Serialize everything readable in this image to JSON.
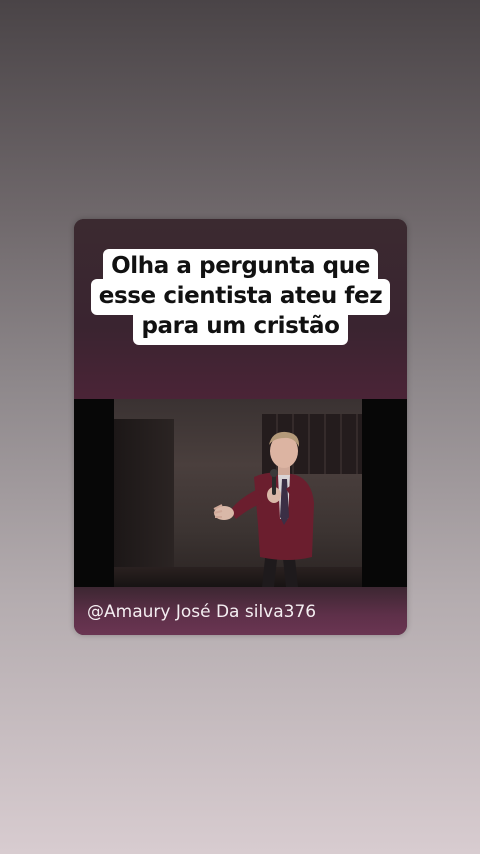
{
  "post": {
    "caption_lines": [
      "Olha a pergunta que",
      "esse cientista ateu fez",
      "para um cristão"
    ],
    "handle": "@Amaury José Da silva376"
  },
  "video": {
    "scene": "man-in-red-blazer-speaking-with-microphone-icon"
  },
  "colors": {
    "caption_bg": "#ffffff",
    "caption_text": "#111111",
    "card_bg": "#2a1b20",
    "handle_text": "#f4eef1"
  }
}
